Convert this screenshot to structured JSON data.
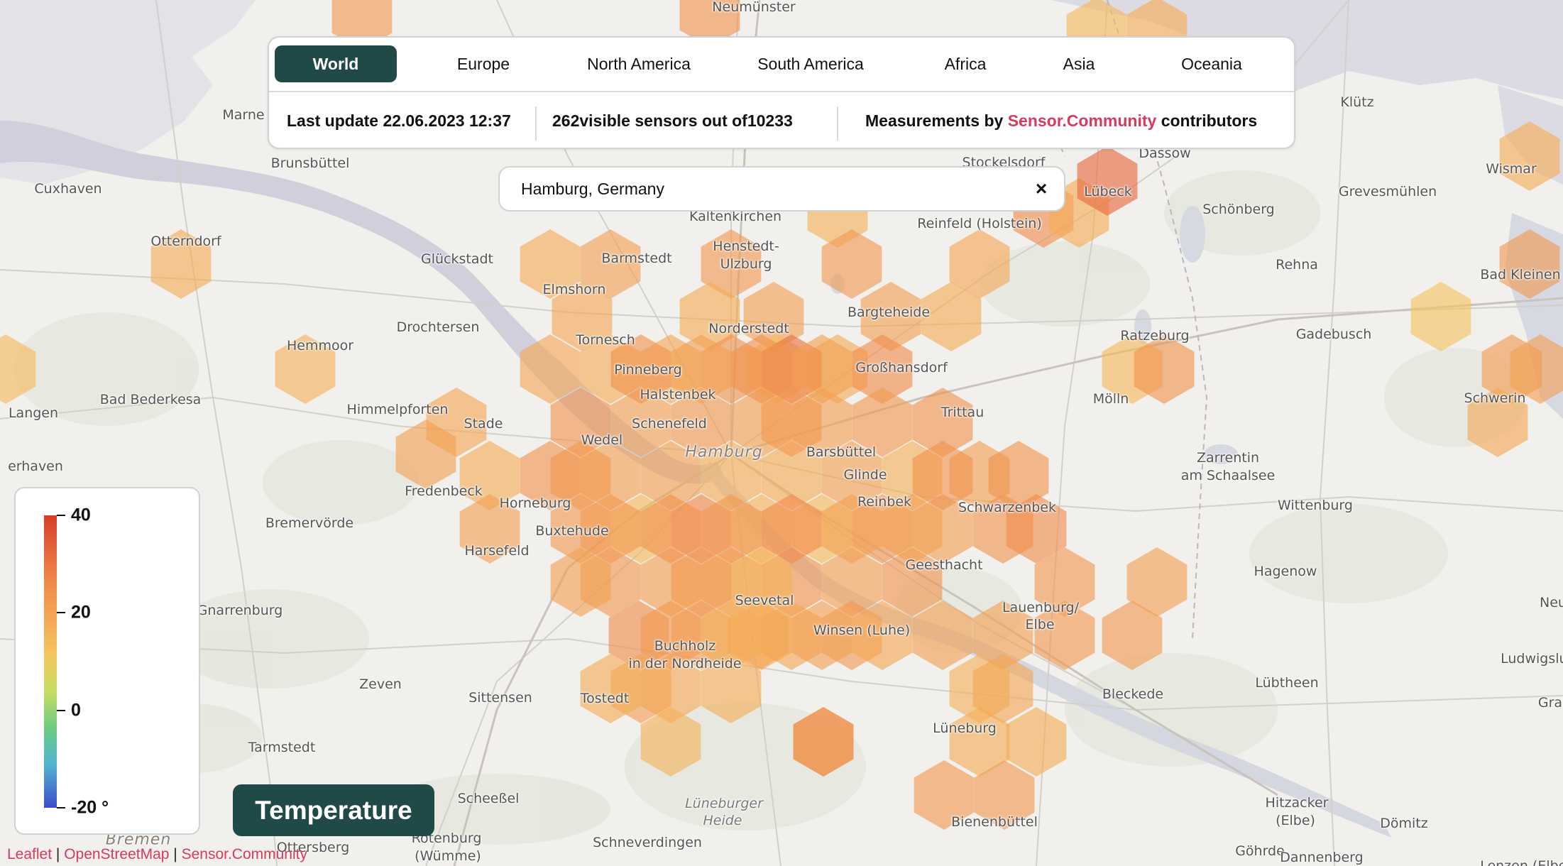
{
  "region_tabs": [
    {
      "label": "World",
      "active": true
    },
    {
      "label": "Europe",
      "active": false
    },
    {
      "label": "North America",
      "active": false
    },
    {
      "label": "South America",
      "active": false
    },
    {
      "label": "Africa",
      "active": false
    },
    {
      "label": "Asia",
      "active": false
    },
    {
      "label": "Oceania",
      "active": false
    }
  ],
  "info": {
    "last_update": "Last update 22.06.2023 12:37",
    "visible_count": "262",
    "visible_mid": "visible sensors out of",
    "total_count": "10233",
    "measurements_prefix": "Measurements by ",
    "measurements_link": "Sensor.Community",
    "measurements_suffix": " contributors"
  },
  "search": {
    "value": "Hamburg, Germany",
    "clear_icon": "close-icon"
  },
  "legend": {
    "ticks": [
      {
        "label": "40",
        "value": 40
      },
      {
        "label": "20",
        "value": 20
      },
      {
        "label": "0",
        "value": 0
      },
      {
        "label": "-20 °",
        "value": -20
      }
    ],
    "min": -20,
    "max": 40
  },
  "metric_button": "Temperature",
  "attribution": {
    "items": [
      "Leaflet",
      "OpenStreetMap",
      "Sensor.Community"
    ],
    "separator": " | "
  },
  "map": {
    "place_labels": [
      "Neumünster",
      "Marne",
      "Brunsbüttel",
      "Cuxhaven",
      "Otterndorf",
      "Glückstadt",
      "Barmstedt",
      "Henstedt-",
      "Ulzburg",
      "Kaltenkirchen",
      "Elmshorn",
      "Drochtersen",
      "Hemmoor",
      "Tornesch",
      "Norderstedt",
      "Bargteheide",
      "Reinfeld (Holstein)",
      "Stockelsdorf",
      "Lübeck",
      "Dassow",
      "Wismar",
      "Klütz",
      "Grevesmühlen",
      "Schönberg",
      "Rehna",
      "Bad Kleinen",
      "Gadebusch",
      "Ratzeburg",
      "Pinneberg",
      "Großhansdorf",
      "Langen",
      "Bad Bederkesa",
      "Himmelpforten",
      "Stade",
      "Halstenbek",
      "Schenefeld",
      "Wedel",
      "Hamburg",
      "Barsbüttel",
      "Glinde",
      "Trittau",
      "Mölln",
      "Schwerin",
      "Zarrentin",
      "am Schaalsee",
      "erhaven",
      "Fredenbeck",
      "Horneburg",
      "Reinbek",
      "Schwarzenbek",
      "Bremervörde",
      "Buxtehude",
      "Harsefeld",
      "Wittenburg",
      "Geesthacht",
      "Hagenow",
      "Gnarrenburg",
      "Seevetal",
      "Lauenburg/",
      "Elbe",
      "Winsen (Luhe)",
      "Buchholz",
      "in der Nordheide",
      "Zeven",
      "Sittensen",
      "Tostedt",
      "Bleckede",
      "Lübtheen",
      "Ludwigslust",
      "Tarmstedt",
      "Lüneburg",
      "Scheeßel",
      "Lüneburger",
      "Heide",
      "Hitzacker",
      "(Elbe)",
      "Dömitz",
      "Bienenbüttel",
      "Schneverdingen",
      "Ottersberg",
      "Rotenburg",
      "(Wümme)",
      "Bremen",
      "Göhrde",
      "Dannenberg",
      "Lenzen (Elbe)",
      "Grab",
      "Neu"
    ],
    "hex_values": [
      27,
      28,
      22,
      24,
      23,
      29,
      24,
      34,
      24,
      24,
      24,
      26,
      27,
      27,
      25,
      27,
      25,
      24,
      26,
      26,
      24,
      20,
      22,
      21,
      24,
      22,
      28,
      27,
      23,
      25,
      24,
      25,
      28,
      33,
      28,
      26,
      27,
      26,
      26,
      25,
      25,
      26,
      26,
      26,
      26,
      24,
      24,
      26,
      23,
      26,
      22,
      30,
      23,
      22,
      28,
      26,
      28,
      27,
      26,
      26,
      28,
      26,
      28,
      26,
      27,
      25,
      26,
      26,
      27,
      29,
      26,
      25,
      25,
      24,
      24,
      23,
      29,
      24,
      24,
      23,
      27,
      27,
      28,
      27,
      29,
      26,
      26,
      28,
      26,
      28,
      26,
      29,
      27,
      28,
      27,
      28,
      25,
      27,
      27,
      28,
      29,
      24,
      25,
      27,
      28,
      24,
      26,
      27,
      27,
      26,
      25,
      23,
      27,
      26,
      27,
      28,
      27,
      30,
      26,
      25,
      26,
      26,
      27,
      27,
      25
    ]
  }
}
